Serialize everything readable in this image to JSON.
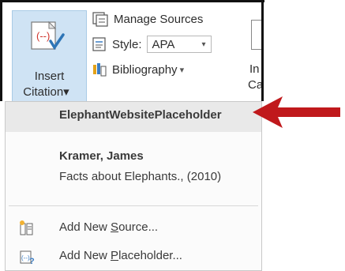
{
  "ribbon": {
    "insert_citation": {
      "line1": "Insert",
      "line2": "Citation",
      "caret": "▾"
    },
    "manage_sources_label": "Manage Sources",
    "style_label": "Style:",
    "style_value": "APA",
    "bibliography_label": "Bibliography",
    "bibliography_caret": "▾",
    "right_fragments": {
      "top": "In",
      "bottom": "Ca"
    }
  },
  "menu": {
    "placeholder_entry": "ElephantWebsitePlaceholder",
    "source": {
      "author": "Kramer, James",
      "title": "Facts about Elephants., (2010)"
    },
    "add_new_source": {
      "before": "Add New ",
      "accel": "S",
      "after": "ource..."
    },
    "add_new_placeholder": {
      "before": "Add New ",
      "accel": "P",
      "after": "laceholder..."
    }
  },
  "colors": {
    "arrow": "#c0191c",
    "button_highlight": "#cfe3f4",
    "menu_hover": "#e9e9e9"
  }
}
